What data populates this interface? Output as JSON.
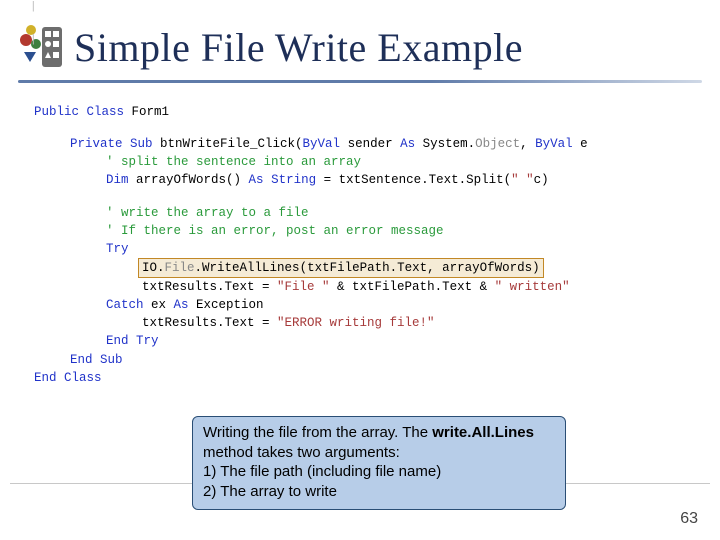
{
  "title": "Simple File Write Example",
  "page_number": "63",
  "code": {
    "l1_public": "Public Class",
    "l1_name": " Form1",
    "l2_pref": "Private Sub",
    "l2_evt": " btnWriteFile_Click(",
    "l2_byval1": "ByVal",
    "l2_sender": " sender ",
    "l2_as1": "As",
    "l2_sysobj": " System.",
    "l2_obj_gray": "Object",
    "l2_comma": ", ",
    "l2_byval2": "ByVal",
    "l2_e": " e",
    "cm_split": "' split the sentence into an array",
    "l3_dim": "Dim",
    "l3_arr": " arrayOfWords() ",
    "l3_as": "As",
    "l3_str": " String",
    "l3_eq": " = txtSentence.Text.Split(",
    "l3_lit": "\" \"",
    "l3_tail": "c)",
    "cm_w1": "' write the array to a file",
    "cm_w2": "' If there is an error, post an error message",
    "try": "Try",
    "hi_pre": "IO.",
    "hi_gray": "File",
    "hi_mid": ".",
    "hi_call": "WriteAllLines(txtFilePath.Text, arrayOfWords)",
    "res1_a": "txtResults.Text = ",
    "res1_s1": "\"File \"",
    "res1_mid": " & txtFilePath.Text & ",
    "res1_s2": "\" written\"",
    "catch": "Catch",
    "ex": " ex ",
    "as2": "As",
    "exc": " Exception",
    "err_a": "txtResults.Text = ",
    "err_s": "\"ERROR writing file!\"",
    "endtry": "End Try",
    "endsub": "End Sub",
    "endclass": "End Class"
  },
  "annotation": {
    "line1": "Writing the file from the array. The ",
    "bold": "write.All.Lines",
    "line2_rest": " method takes two arguments:",
    "li1": "1)  The file path (including file name)",
    "li2": "2)  The array to write"
  }
}
